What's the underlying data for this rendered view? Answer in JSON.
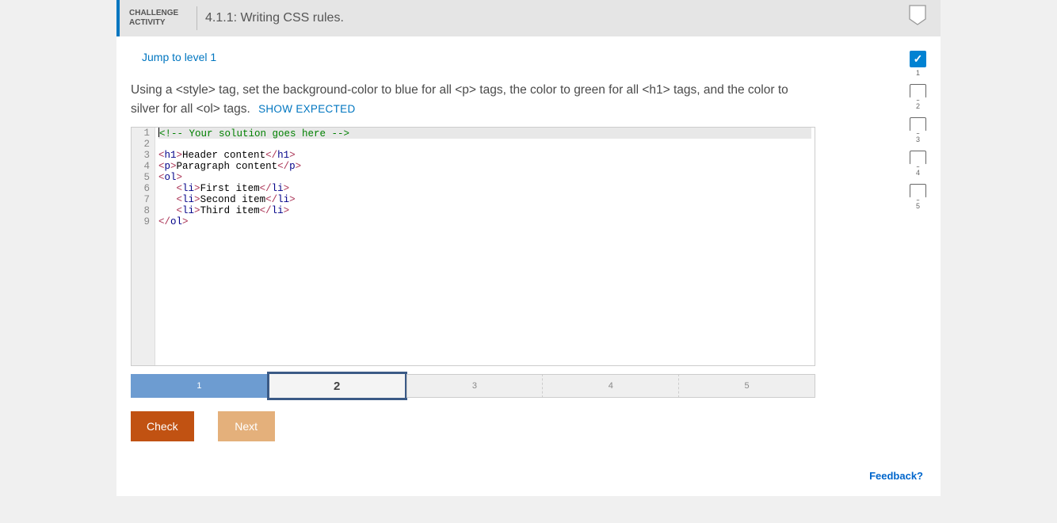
{
  "header": {
    "label_line1": "CHALLENGE",
    "label_line2": "ACTIVITY",
    "title": "4.1.1: Writing CSS rules."
  },
  "jump_link": "Jump to level 1",
  "instructions_html": "Using a <style> tag, set the background-color to blue for all <p> tags, the color to green for all <h1> tags, and the color to silver for all <ol> tags.",
  "show_expected": "SHOW EXPECTED",
  "code": {
    "lines": [
      {
        "n": "1",
        "type": "comment",
        "raw": "<!-- Your solution goes here -->"
      },
      {
        "n": "2",
        "type": "blank",
        "raw": ""
      },
      {
        "n": "3",
        "type": "tag",
        "open": "h1",
        "text": "Header content",
        "close": "h1"
      },
      {
        "n": "4",
        "type": "tag",
        "open": "p",
        "text": "Paragraph content",
        "close": "p"
      },
      {
        "n": "5",
        "type": "open",
        "tag": "ol"
      },
      {
        "n": "6",
        "type": "li",
        "indent": "   ",
        "text": "First item"
      },
      {
        "n": "7",
        "type": "li",
        "indent": "   ",
        "text": "Second item"
      },
      {
        "n": "8",
        "type": "li",
        "indent": "   ",
        "text": "Third item"
      },
      {
        "n": "9",
        "type": "close",
        "tag": "ol"
      }
    ]
  },
  "steps": [
    {
      "n": "1",
      "state": "completed"
    },
    {
      "n": "2",
      "state": "current"
    },
    {
      "n": "3",
      "state": "pending"
    },
    {
      "n": "4",
      "state": "pending"
    },
    {
      "n": "5",
      "state": "pending"
    }
  ],
  "progress": [
    {
      "n": "1",
      "done": true
    },
    {
      "n": "2",
      "done": false
    },
    {
      "n": "3",
      "done": false
    },
    {
      "n": "4",
      "done": false
    },
    {
      "n": "5",
      "done": false
    }
  ],
  "buttons": {
    "check": "Check",
    "next": "Next"
  },
  "feedback": "Feedback?"
}
